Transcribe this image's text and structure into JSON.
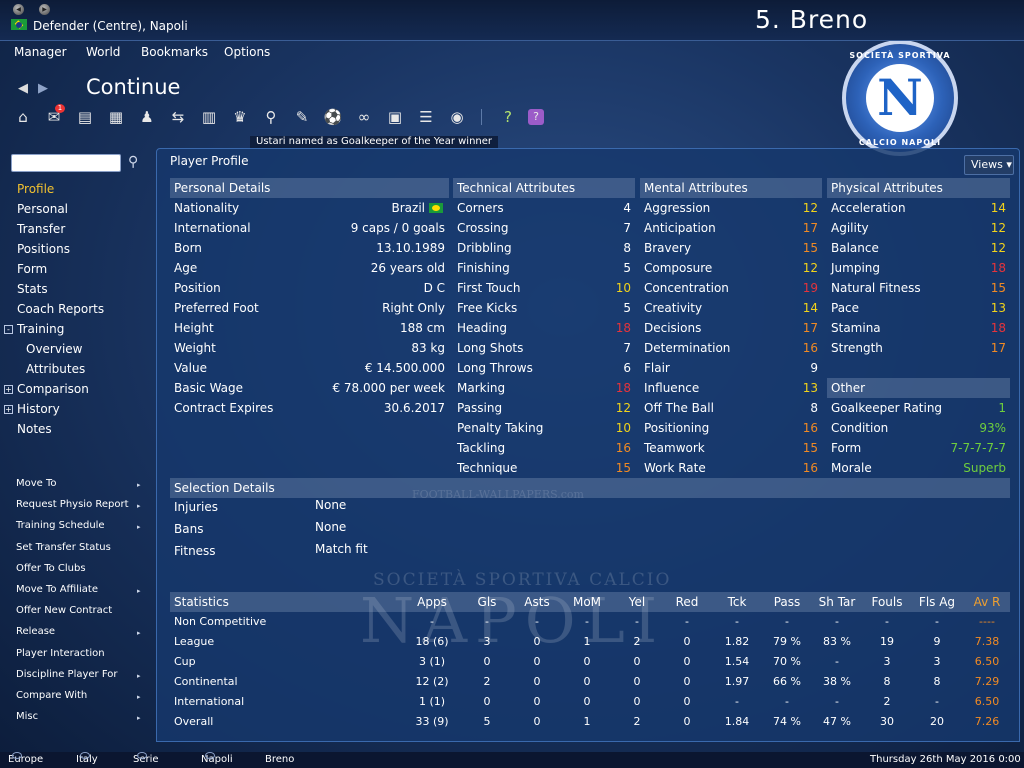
{
  "window": {
    "subtitle": "Defender (Centre), Napoli",
    "player_title": "5. Breno"
  },
  "menu": [
    "Manager",
    "World",
    "Bookmarks",
    "Options"
  ],
  "nav": {
    "title": "Continue",
    "badge": "1"
  },
  "news": "Ustari named as Goalkeeper of the Year winner",
  "crest": {
    "top": "SOCIETÀ SPORTIVA",
    "letter": "N",
    "bottom": "CALCIO NAPOLI"
  },
  "watermark": {
    "line1": "SOCIETÀ SPORTIVA CALCIO",
    "line2": "NAPOLI",
    "site": "FOOTBALL-WALLPAPERS.com"
  },
  "search": {
    "placeholder": ""
  },
  "sidebar": {
    "items": [
      {
        "label": "Profile",
        "active": true
      },
      {
        "label": "Personal"
      },
      {
        "label": "Transfer"
      },
      {
        "label": "Positions"
      },
      {
        "label": "Form"
      },
      {
        "label": "Stats"
      },
      {
        "label": "Coach Reports"
      },
      {
        "label": "Training",
        "expander": "-"
      },
      {
        "label": "Overview",
        "sub": true
      },
      {
        "label": "Attributes",
        "sub": true
      },
      {
        "label": "Comparison",
        "expander": "+"
      },
      {
        "label": "History",
        "expander": "+"
      },
      {
        "label": "Notes"
      }
    ],
    "actions": [
      "Move To",
      "Request Physio Report",
      "Training Schedule",
      "Set Transfer Status",
      "Offer To Clubs",
      "Move To Affiliate",
      "Offer New Contract",
      "Release",
      "Player Interaction",
      "Discipline Player For",
      "Compare With",
      "Misc"
    ],
    "action_arrows": [
      true,
      true,
      true,
      false,
      false,
      true,
      false,
      true,
      false,
      true,
      true,
      true
    ]
  },
  "profile": {
    "title": "Player Profile",
    "views_label": "Views ▾"
  },
  "personal": {
    "header": "Personal Details",
    "rows": [
      [
        "Nationality",
        "Brazil"
      ],
      [
        "International",
        "9 caps / 0 goals"
      ],
      [
        "Born",
        "13.10.1989"
      ],
      [
        "Age",
        "26 years old"
      ],
      [
        "Position",
        "D C"
      ],
      [
        "Preferred Foot",
        "Right Only"
      ],
      [
        "Height",
        "188 cm"
      ],
      [
        "Weight",
        "83 kg"
      ],
      [
        "Value",
        "€ 14.500.000"
      ],
      [
        "Basic Wage",
        "€ 78.000 per week"
      ],
      [
        "Contract Expires",
        "30.6.2017"
      ]
    ]
  },
  "technical": {
    "header": "Technical Attributes",
    "rows": [
      [
        "Corners",
        "4"
      ],
      [
        "Crossing",
        "7"
      ],
      [
        "Dribbling",
        "8"
      ],
      [
        "Finishing",
        "5"
      ],
      [
        "First Touch",
        "10"
      ],
      [
        "Free Kicks",
        "5"
      ],
      [
        "Heading",
        "18"
      ],
      [
        "Long Shots",
        "7"
      ],
      [
        "Long Throws",
        "6"
      ],
      [
        "Marking",
        "18"
      ],
      [
        "Passing",
        "12"
      ],
      [
        "Penalty Taking",
        "10"
      ],
      [
        "Tackling",
        "16"
      ],
      [
        "Technique",
        "15"
      ]
    ]
  },
  "mental": {
    "header": "Mental Attributes",
    "rows": [
      [
        "Aggression",
        "12"
      ],
      [
        "Anticipation",
        "17"
      ],
      [
        "Bravery",
        "15"
      ],
      [
        "Composure",
        "12"
      ],
      [
        "Concentration",
        "19"
      ],
      [
        "Creativity",
        "14"
      ],
      [
        "Decisions",
        "17"
      ],
      [
        "Determination",
        "16"
      ],
      [
        "Flair",
        "9"
      ],
      [
        "Influence",
        "13"
      ],
      [
        "Off The Ball",
        "8"
      ],
      [
        "Positioning",
        "16"
      ],
      [
        "Teamwork",
        "15"
      ],
      [
        "Work Rate",
        "16"
      ]
    ]
  },
  "physical": {
    "header": "Physical Attributes",
    "rows": [
      [
        "Acceleration",
        "14"
      ],
      [
        "Agility",
        "12"
      ],
      [
        "Balance",
        "12"
      ],
      [
        "Jumping",
        "18"
      ],
      [
        "Natural Fitness",
        "15"
      ],
      [
        "Pace",
        "13"
      ],
      [
        "Stamina",
        "18"
      ],
      [
        "Strength",
        "17"
      ]
    ]
  },
  "other": {
    "header": "Other",
    "rows": [
      [
        "Goalkeeper Rating",
        "1",
        "#6fcf3d"
      ],
      [
        "Condition",
        "93%",
        "#6fcf3d"
      ],
      [
        "Form",
        "7-7-7-7-7",
        "#6fcf3d"
      ],
      [
        "Morale",
        "Superb",
        "#6fcf3d"
      ]
    ]
  },
  "selection": {
    "header": "Selection Details",
    "rows": [
      [
        "Injuries",
        "None"
      ],
      [
        "Bans",
        "None"
      ],
      [
        "Fitness",
        "Match fit"
      ]
    ]
  },
  "statistics": {
    "headers": [
      "Statistics",
      "Apps",
      "Gls",
      "Asts",
      "MoM",
      "Yel",
      "Red",
      "Tck",
      "Pass",
      "Sh Tar",
      "Fouls",
      "Fls Ag",
      "Av R"
    ],
    "rows": [
      [
        "Non Competitive",
        "-",
        "-",
        "-",
        "-",
        "-",
        "-",
        "-",
        "-",
        "-",
        "-",
        "-",
        "----"
      ],
      [
        "League",
        "18 (6)",
        "3",
        "0",
        "1",
        "2",
        "0",
        "1.82",
        "79 %",
        "83 %",
        "19",
        "9",
        "7.38"
      ],
      [
        "Cup",
        "3 (1)",
        "0",
        "0",
        "0",
        "0",
        "0",
        "1.54",
        "70 %",
        "-",
        "3",
        "3",
        "6.50"
      ],
      [
        "Continental",
        "12 (2)",
        "2",
        "0",
        "0",
        "0",
        "0",
        "1.97",
        "66 %",
        "38 %",
        "8",
        "8",
        "7.29"
      ],
      [
        "International",
        "1 (1)",
        "0",
        "0",
        "0",
        "0",
        "0",
        "-",
        "-",
        "-",
        "2",
        "-",
        "6.50"
      ],
      [
        "Overall",
        "33 (9)",
        "5",
        "0",
        "1",
        "2",
        "0",
        "1.84",
        "74 %",
        "47 %",
        "30",
        "20",
        "7.26"
      ]
    ]
  },
  "statusbar": {
    "crumbs": [
      "Europe",
      "Italy",
      "Serie A",
      "Napoli",
      "Breno"
    ],
    "date": "Thursday 26th May 2016 0:00"
  },
  "colors": {
    "high": "#e5343b",
    "good": "#f08a24",
    "mid": "#f2d21b",
    "low": "#ffffff",
    "accent_green": "#6fcf3d",
    "header_orange": "#f0a030"
  }
}
